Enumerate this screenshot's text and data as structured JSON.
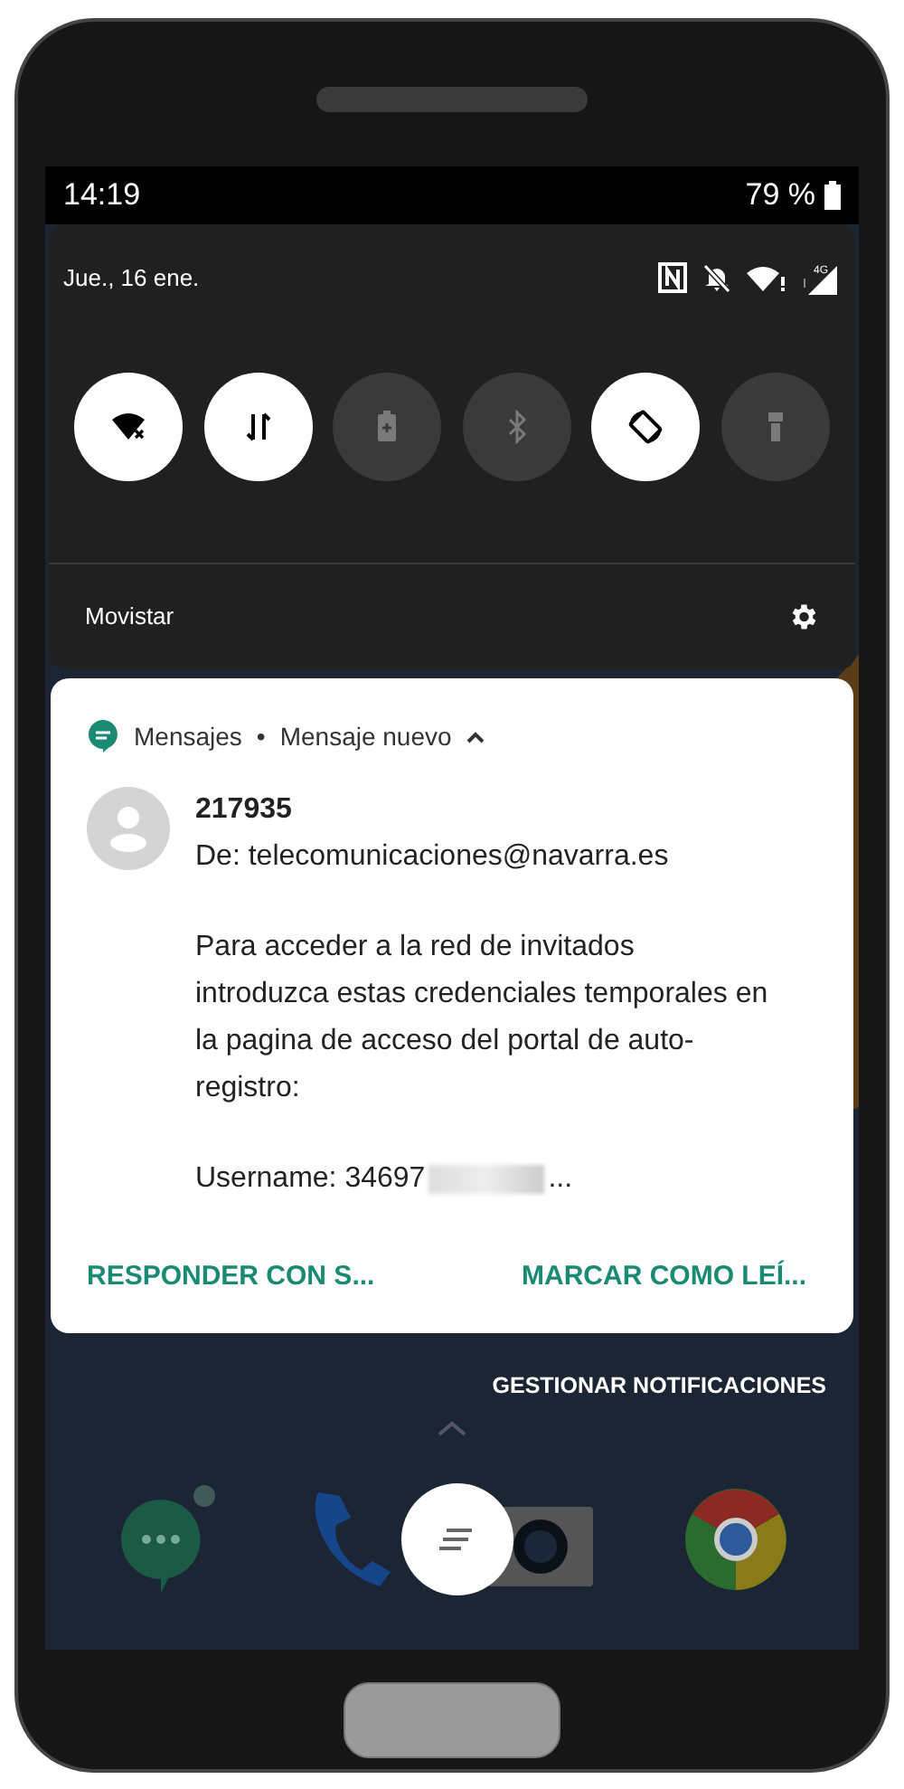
{
  "status_bar": {
    "time": "14:19",
    "battery": "79 %"
  },
  "quick_settings": {
    "date": "Jue., 16 ene.",
    "network": "4G",
    "carrier": "Movistar",
    "tiles": [
      {
        "kind": "wifi",
        "on": true
      },
      {
        "kind": "data",
        "on": true
      },
      {
        "kind": "battery_saver",
        "on": false
      },
      {
        "kind": "bluetooth",
        "on": false
      },
      {
        "kind": "rotate",
        "on": true
      },
      {
        "kind": "flashlight",
        "on": false
      }
    ]
  },
  "notification": {
    "app": "Mensajes",
    "separator": "•",
    "category": "Mensaje nuevo",
    "expanded": true,
    "sender": "217935",
    "from": "De: telecomunicaciones@navarra.es",
    "body": "Para acceder a la red de invitados introduzca estas credenciales temporales en la pagina de acceso del portal de auto-registro:",
    "username": "Username: 34697",
    "username_more": "...",
    "actions": [
      "RESPONDER CON S...",
      "MARCAR COMO LEÍ..."
    ]
  },
  "manage_button": "GESTIONAR NOTIFICACIONES"
}
